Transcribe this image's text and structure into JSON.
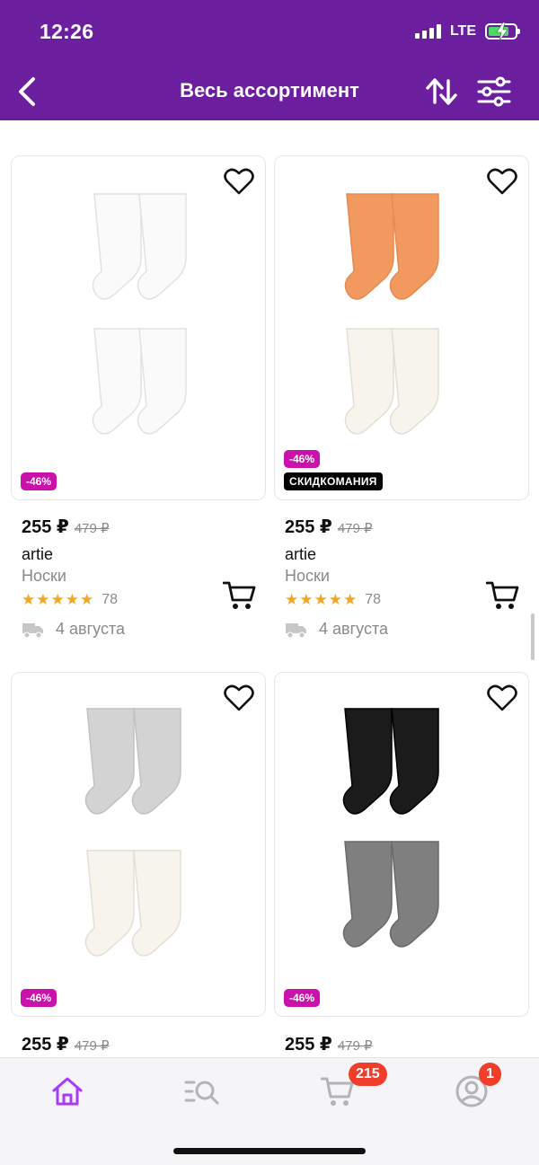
{
  "status_bar": {
    "time": "12:26",
    "network": "LTE"
  },
  "header": {
    "title": "Весь ассортимент"
  },
  "products": [
    {
      "discount": "-46%",
      "promo": "",
      "price": "255 ₽",
      "old_price": "479 ₽",
      "brand": "artie",
      "category": "Носки",
      "rating": "★★★★★",
      "reviews": "78",
      "delivery": "4 августа",
      "colors": [
        "#f7f7f7",
        "#f7f7f7"
      ]
    },
    {
      "discount": "-46%",
      "promo": "СКИДКОМАНИЯ",
      "price": "255 ₽",
      "old_price": "479 ₽",
      "brand": "artie",
      "category": "Носки",
      "rating": "★★★★★",
      "reviews": "78",
      "delivery": "4 августа",
      "colors": [
        "#f2995f",
        "#f6f4ec"
      ]
    },
    {
      "discount": "-46%",
      "promo": "",
      "price": "255 ₽",
      "old_price": "479 ₽",
      "colors": [
        "#d3d3d3",
        "#f6f4ec"
      ]
    },
    {
      "discount": "-46%",
      "promo": "",
      "price": "255 ₽",
      "old_price": "479 ₽",
      "colors": [
        "#1b1b1b",
        "#7f7f7f"
      ]
    }
  ],
  "tabbar": {
    "items": [
      {
        "name": "home",
        "icon": "home-icon",
        "active": true
      },
      {
        "name": "catalog",
        "icon": "search-list-icon"
      },
      {
        "name": "cart",
        "icon": "cart-icon",
        "badge": "215"
      },
      {
        "name": "profile",
        "icon": "profile-icon",
        "badge": "1"
      }
    ]
  },
  "colors": {
    "brand": "#6b1f9e",
    "discount": "#cb11ab",
    "star": "#f4a622",
    "badge": "#f03e2b",
    "active_tab": "#a73afd"
  }
}
